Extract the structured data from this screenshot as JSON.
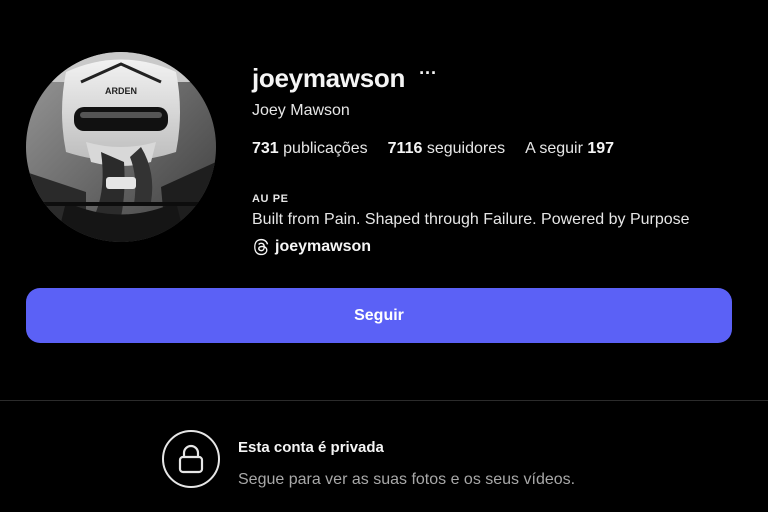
{
  "profile": {
    "username": "joeymawson",
    "more_icon": "···",
    "full_name": "Joey Mawson",
    "stats": {
      "posts_count": "731",
      "posts_label": "publicações",
      "followers_count": "7116",
      "followers_label": "seguidores",
      "following_label": "A seguir",
      "following_count": "197"
    },
    "category": "AU PE",
    "bio": "Built from Pain. Shaped through Failure. Powered by Purpose",
    "threads_handle": "joeymawson",
    "follow_label": "Seguir"
  },
  "private_notice": {
    "title": "Esta conta é privada",
    "subtitle": "Segue para ver as suas fotos e os seus vídeos."
  },
  "icons": {
    "more": "more-options-icon",
    "threads": "threads-icon",
    "lock": "lock-icon"
  },
  "colors": {
    "background": "#000000",
    "follow_button": "#5b61f6",
    "text_primary": "#f5f5f5",
    "text_secondary": "#a8a8a8",
    "divider": "#2b2b2b"
  }
}
